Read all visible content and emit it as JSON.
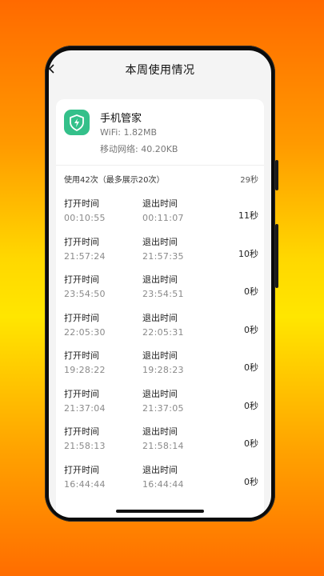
{
  "header": {
    "title": "本周使用情况"
  },
  "app": {
    "name": "手机管家",
    "wifi": "WiFi: 1.82MB",
    "mobile": "移动网络: 40.20KB",
    "icon": "shield-lightning-icon",
    "icon_color": "#34c08a"
  },
  "summary": {
    "text": "使用42次（最多展示20次）",
    "total": "29秒"
  },
  "labels": {
    "open": "打开时间",
    "exit": "退出时间"
  },
  "sessions": [
    {
      "open": "00:10:55",
      "exit": "00:11:07",
      "duration": "11秒"
    },
    {
      "open": "21:57:24",
      "exit": "21:57:35",
      "duration": "10秒"
    },
    {
      "open": "23:54:50",
      "exit": "23:54:51",
      "duration": "0秒"
    },
    {
      "open": "22:05:30",
      "exit": "22:05:31",
      "duration": "0秒"
    },
    {
      "open": "19:28:22",
      "exit": "19:28:23",
      "duration": "0秒"
    },
    {
      "open": "21:37:04",
      "exit": "21:37:05",
      "duration": "0秒"
    },
    {
      "open": "21:58:13",
      "exit": "21:58:14",
      "duration": "0秒"
    },
    {
      "open": "16:44:44",
      "exit": "16:44:44",
      "duration": "0秒"
    }
  ]
}
